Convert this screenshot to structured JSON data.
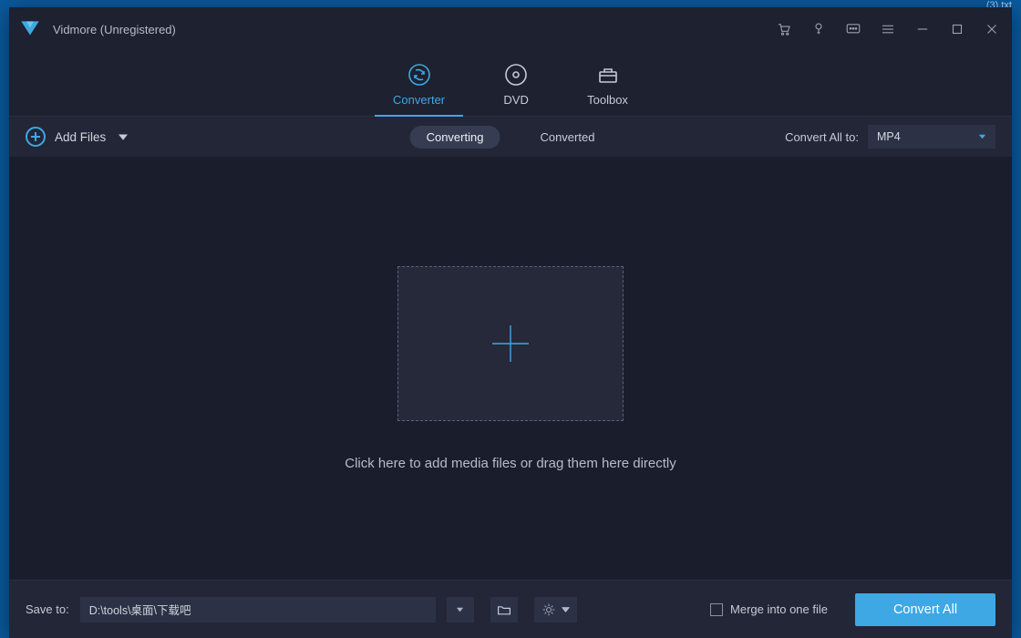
{
  "desktop_remnant": "(3).txt",
  "app_title": "Vidmore (Unregistered)",
  "main_tabs": [
    {
      "label": "Converter",
      "active": true
    },
    {
      "label": "DVD",
      "active": false
    },
    {
      "label": "Toolbox",
      "active": false
    }
  ],
  "toolbar": {
    "add_files": "Add Files",
    "status_pills": [
      {
        "label": "Converting",
        "active": true
      },
      {
        "label": "Converted",
        "active": false
      }
    ],
    "convert_all_to_label": "Convert All to:",
    "format_selected": "MP4"
  },
  "workspace": {
    "hint": "Click here to add media files or drag them here directly"
  },
  "footer": {
    "save_to_label": "Save to:",
    "save_path": "D:\\tools\\桌面\\下载吧",
    "merge_label": "Merge into one file",
    "convert_button": "Convert All"
  }
}
